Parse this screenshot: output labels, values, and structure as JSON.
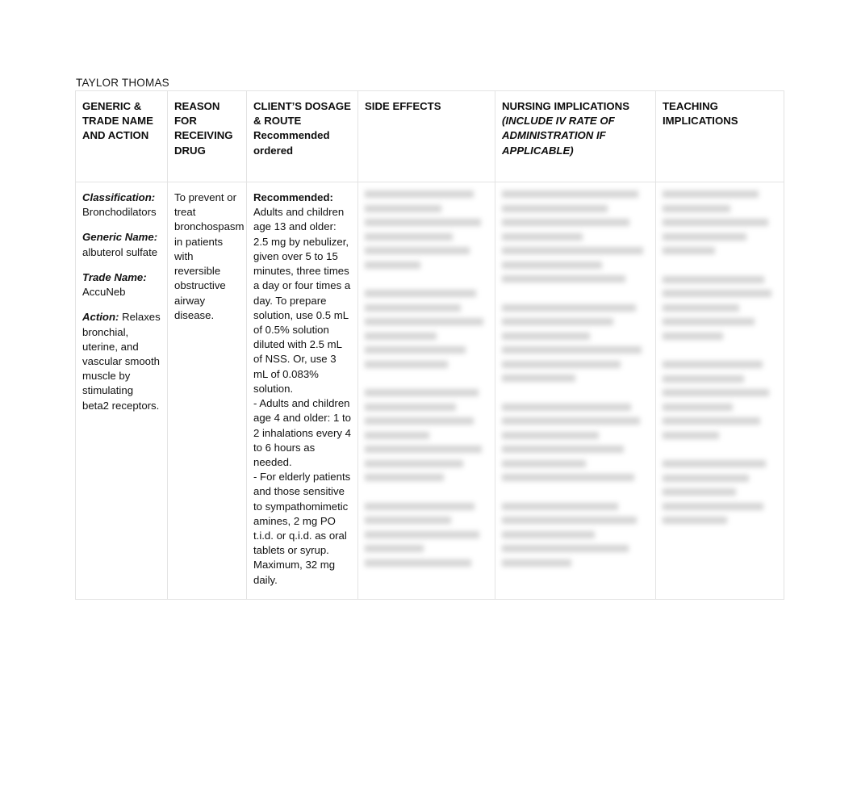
{
  "document": {
    "student_name": "TAYLOR THOMAS"
  },
  "table": {
    "headers": [
      {
        "id": "generic-trade-name-and-action",
        "line1": "GENERIC &",
        "line2": "TRADE NAME",
        "line3": "AND ACTION"
      },
      {
        "id": "reason-for-receiving-drug",
        "line1": "REASON FOR",
        "line2": "RECEIVING",
        "line3": "DRUG"
      },
      {
        "id": "clients-dosage-and-route",
        "line1": "CLIENT’S DOSAGE",
        "line2": " & ROUTE",
        "line3": "Recommended",
        "line4": "ordered"
      },
      {
        "id": "side-effects",
        "line1": "SIDE EFFECTS"
      },
      {
        "id": "nursing-implications",
        "line1": "NURSING IMPLICATIONS",
        "italic1": "(INCLUDE IV RATE OF",
        "italic2": "ADMINISTRATION IF",
        "italic3": "APPLICABLE)"
      },
      {
        "id": "teaching-implications",
        "line1": "TEACHING",
        "line2": "IMPLICATIONS"
      }
    ],
    "cells": {
      "generic_trade_name_and_action": {
        "classification_label": "Classification:",
        "classification_value": " Bronchodilators",
        "generic_name_label_line1": "Generic",
        "generic_name_label_line2": "Name:",
        "generic_name_value": " albuterol sulfate",
        "trade_name_label": "Trade Name:",
        "trade_name_value": " AccuNeb",
        "action_label": "Action:",
        "action_value": " Relaxes bronchial, uterine, and vascular smooth muscle by stimulating beta2 receptors."
      },
      "reason_for_receiving_drug": {
        "text": "To prevent or treat bronchospasm in patients with reversible obstructive airway disease."
      },
      "clients_dosage_and_route": {
        "recommended_label": "Recommended:",
        "paragraph_1": "Adults and children age 13 and older: 2.5 mg by nebulizer, given over 5 to 15 minutes, three times a day or four times a day. To prepare solution, use 0.5 mL of 0.5% solution diluted with 2.5 mL of NSS. Or, use 3 mL of 0.083% solution.",
        "paragraph_2": "- Adults and children age 4 and older: 1 to 2 inhalations every 4 to 6 hours as needed.",
        "paragraph_3": "- For elderly patients and those sensitive to sympathomimetic amines, 2 mg PO t.i.d. or q.i.d. as oral tablets or syrup. Maximum, 32 mg daily."
      },
      "side_effects": {
        "content_state": "blurred-illegible"
      },
      "nursing_implications": {
        "content_state": "blurred-illegible"
      },
      "teaching_implications": {
        "content_state": "blurred-illegible"
      }
    }
  },
  "style": {
    "border_color": "#e3e3e3",
    "text_color": "#121212",
    "page_background": "#ffffff",
    "blur_block_color": "#b9b9b9"
  }
}
